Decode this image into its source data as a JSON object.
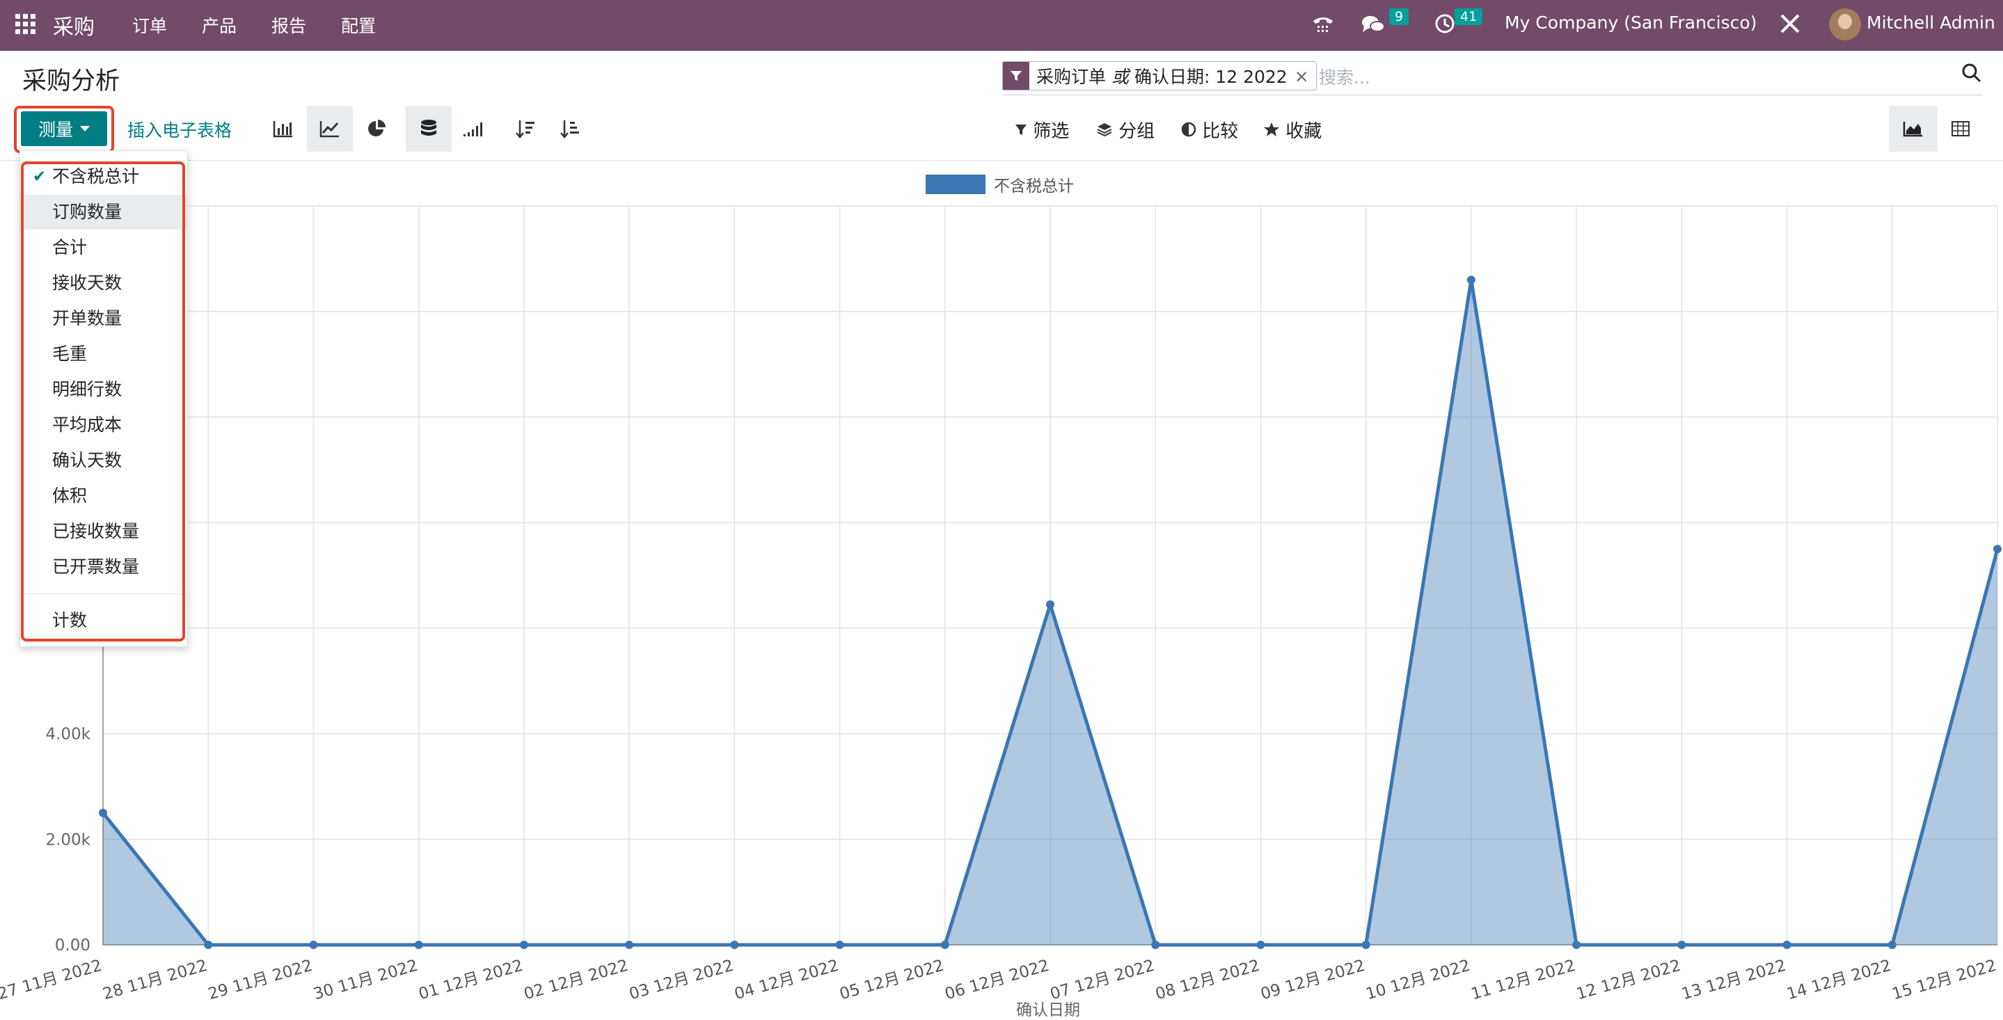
{
  "topbar": {
    "app_name": "采购",
    "menu": [
      "订单",
      "产品",
      "报告",
      "配置"
    ],
    "messages_count": "9",
    "activities_count": "41",
    "company": "My Company (San Francisco)",
    "user": "Mitchell Admin"
  },
  "page": {
    "title": "采购分析"
  },
  "search": {
    "facet_text": "采购订单 或 确认日期: 12 2022",
    "facet_part1": "采购订单",
    "facet_or": "或",
    "facet_part2": "确认日期: 12 2022",
    "facet_remove": "×",
    "placeholder": "搜索..."
  },
  "toolbar": {
    "measure_label": "测量",
    "insert_label": "插入电子表格",
    "filter_label": "筛选",
    "groupby_label": "分组",
    "compare_label": "比较",
    "favorites_label": "收藏"
  },
  "measures": {
    "items": [
      {
        "label": "不含税总计",
        "checked": true
      },
      {
        "label": "订购数量",
        "checked": false
      },
      {
        "label": "合计",
        "checked": false
      },
      {
        "label": "接收天数",
        "checked": false
      },
      {
        "label": "开单数量",
        "checked": false
      },
      {
        "label": "毛重",
        "checked": false
      },
      {
        "label": "明细行数",
        "checked": false
      },
      {
        "label": "平均成本",
        "checked": false
      },
      {
        "label": "确认天数",
        "checked": false
      },
      {
        "label": "体积",
        "checked": false
      },
      {
        "label": "已接收数量",
        "checked": false
      },
      {
        "label": "已开票数量",
        "checked": false
      }
    ],
    "count_label": "计数"
  },
  "colors": {
    "topbar": "#714b67",
    "primary": "#017e84",
    "series": "#3a77b3",
    "highlight": "#e8442c"
  },
  "chart_data": {
    "type": "area",
    "x": [
      "27 11月 2022",
      "28 11月 2022",
      "29 11月 2022",
      "30 11月 2022",
      "01 12月 2022",
      "02 12月 2022",
      "03 12月 2022",
      "04 12月 2022",
      "05 12月 2022",
      "06 12月 2022",
      "07 12月 2022",
      "08 12月 2022",
      "09 12月 2022",
      "10 12月 2022",
      "11 12月 2022",
      "12 12月 2022",
      "13 12月 2022",
      "14 12月 2022",
      "15 12月 2022"
    ],
    "series": [
      {
        "name": "不含税总计",
        "values": [
          2500,
          0,
          0,
          0,
          0,
          0,
          0,
          0,
          0,
          6450,
          0,
          0,
          0,
          12600,
          0,
          0,
          0,
          0,
          7500
        ]
      }
    ],
    "yticks": [
      "0.00",
      "2.00k",
      "4.00k"
    ],
    "ytick_values": [
      0,
      2000,
      4000
    ],
    "ylim": [
      0,
      14000
    ],
    "xlabel": "确认日期",
    "grid": true,
    "legend": "top-center"
  }
}
